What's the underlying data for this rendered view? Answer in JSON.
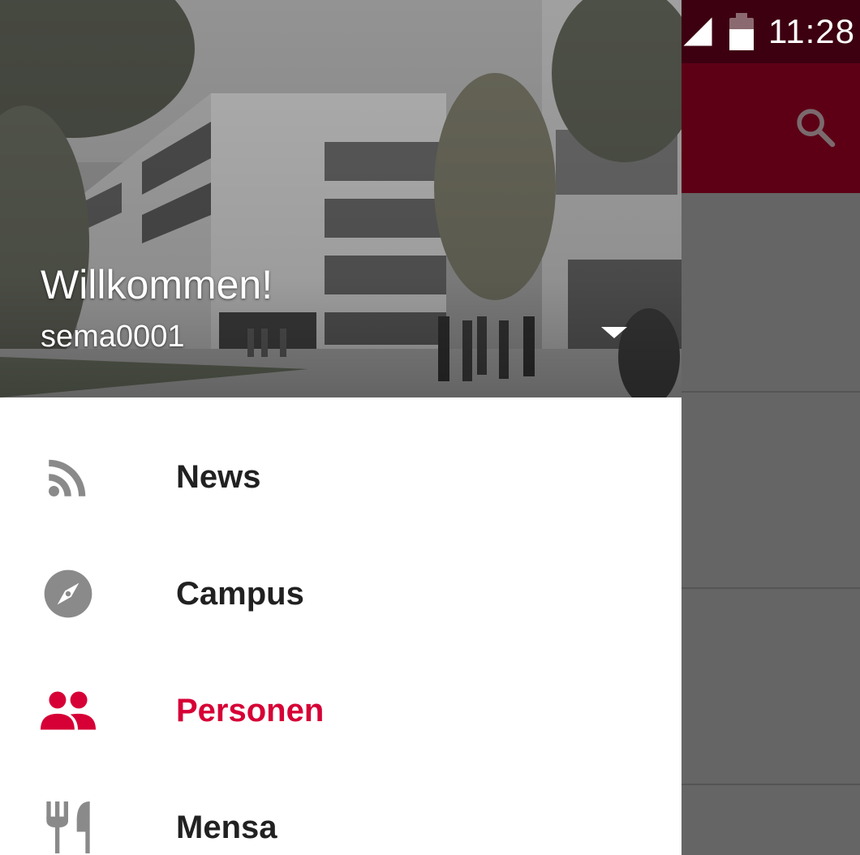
{
  "status_bar": {
    "time": "11:28",
    "signal_icon": "cell-signal-icon",
    "battery_icon": "battery-icon"
  },
  "toolbar": {
    "search_icon": "search-icon",
    "color": "#5d0015"
  },
  "drawer": {
    "header": {
      "welcome": "Willkommen!",
      "username": "sema0001",
      "toggle_icon": "dropdown-arrow-icon"
    },
    "items": [
      {
        "label": "News",
        "icon": "rss-feed-icon",
        "active": false
      },
      {
        "label": "Campus",
        "icon": "compass-icon",
        "active": false
      },
      {
        "label": "Personen",
        "icon": "people-icon",
        "active": true
      },
      {
        "label": "Mensa",
        "icon": "restaurant-icon",
        "active": false
      }
    ],
    "active_color": "#d60036",
    "icon_color": "#8a8a8a"
  }
}
